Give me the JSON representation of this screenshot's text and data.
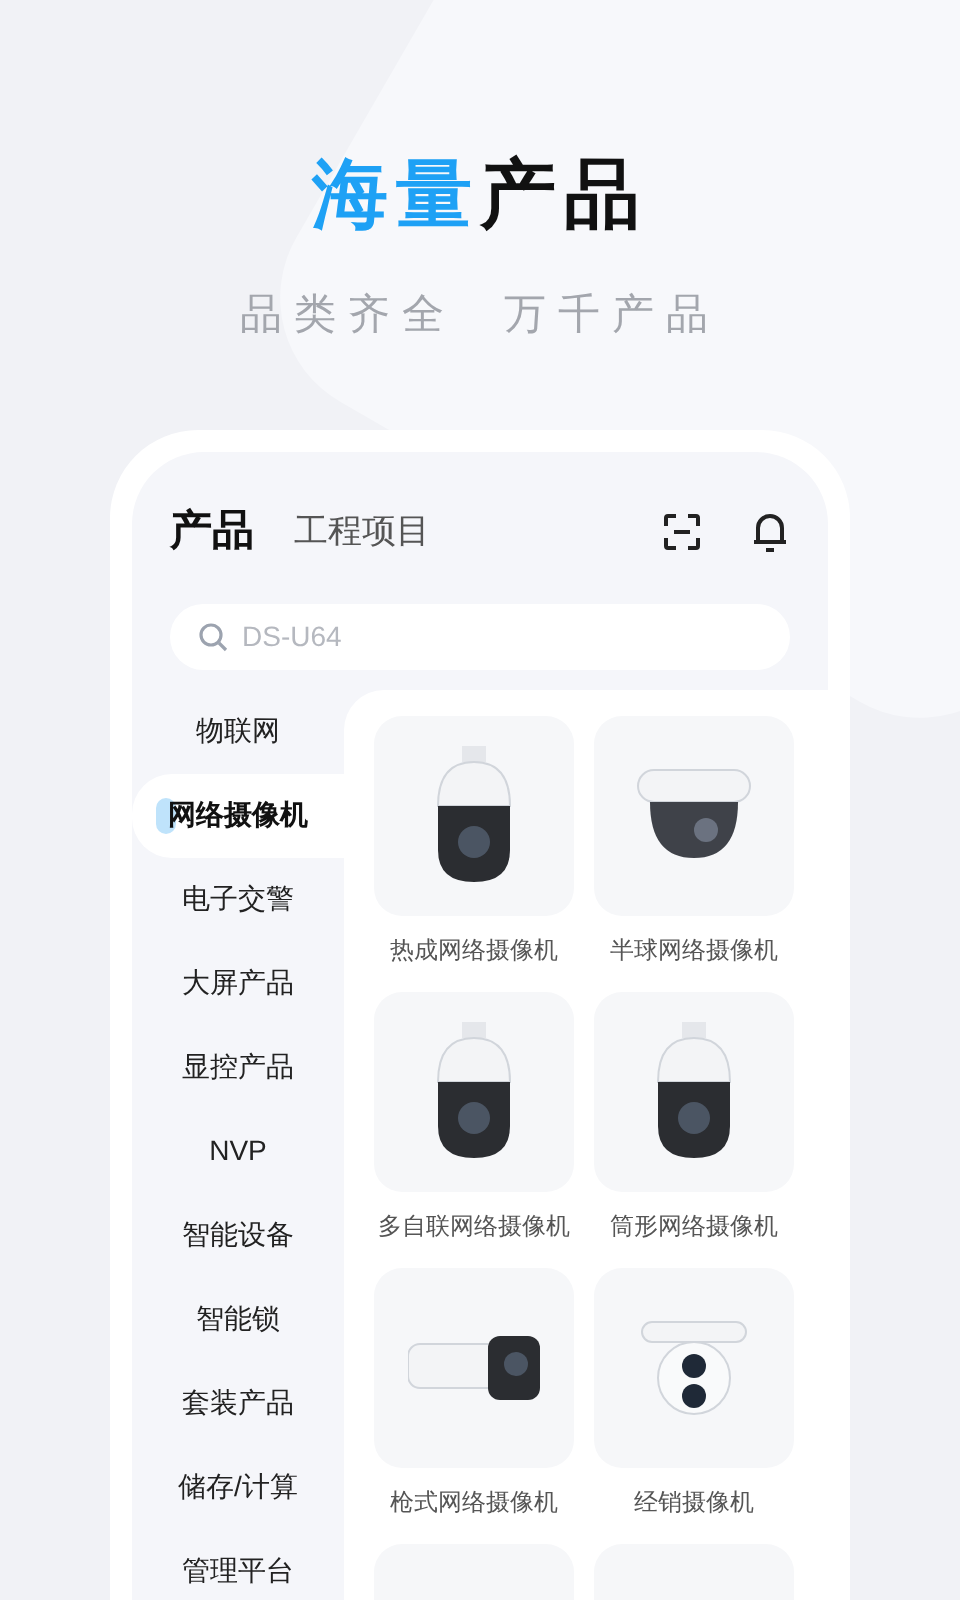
{
  "headline": {
    "accent": "海量",
    "rest": "产品"
  },
  "subtitle": "品类齐全  万千产品",
  "app": {
    "tabs": [
      {
        "label": "产品",
        "selected": true
      },
      {
        "label": "工程项目",
        "selected": false
      }
    ],
    "search": {
      "placeholder": "DS-U64"
    },
    "categories": [
      {
        "label": "物联网",
        "selected": false
      },
      {
        "label": "网络摄像机",
        "selected": true
      },
      {
        "label": "电子交警",
        "selected": false
      },
      {
        "label": "大屏产品",
        "selected": false
      },
      {
        "label": "显控产品",
        "selected": false
      },
      {
        "label": "NVP",
        "selected": false
      },
      {
        "label": "智能设备",
        "selected": false
      },
      {
        "label": "智能锁",
        "selected": false
      },
      {
        "label": "套装产品",
        "selected": false
      },
      {
        "label": "储存/计算",
        "selected": false
      },
      {
        "label": "管理平台",
        "selected": false
      }
    ],
    "products": [
      {
        "name": "热成网络摄像机",
        "kind": "dome"
      },
      {
        "name": "半球网络摄像机",
        "kind": "halfdome"
      },
      {
        "name": "多自联网络摄像机",
        "kind": "dome"
      },
      {
        "name": "筒形网络摄像机",
        "kind": "dome"
      },
      {
        "name": "枪式网络摄像机",
        "kind": "bullet"
      },
      {
        "name": "经销摄像机",
        "kind": "turret"
      },
      {
        "kind": "blank"
      },
      {
        "kind": "blank"
      }
    ]
  }
}
